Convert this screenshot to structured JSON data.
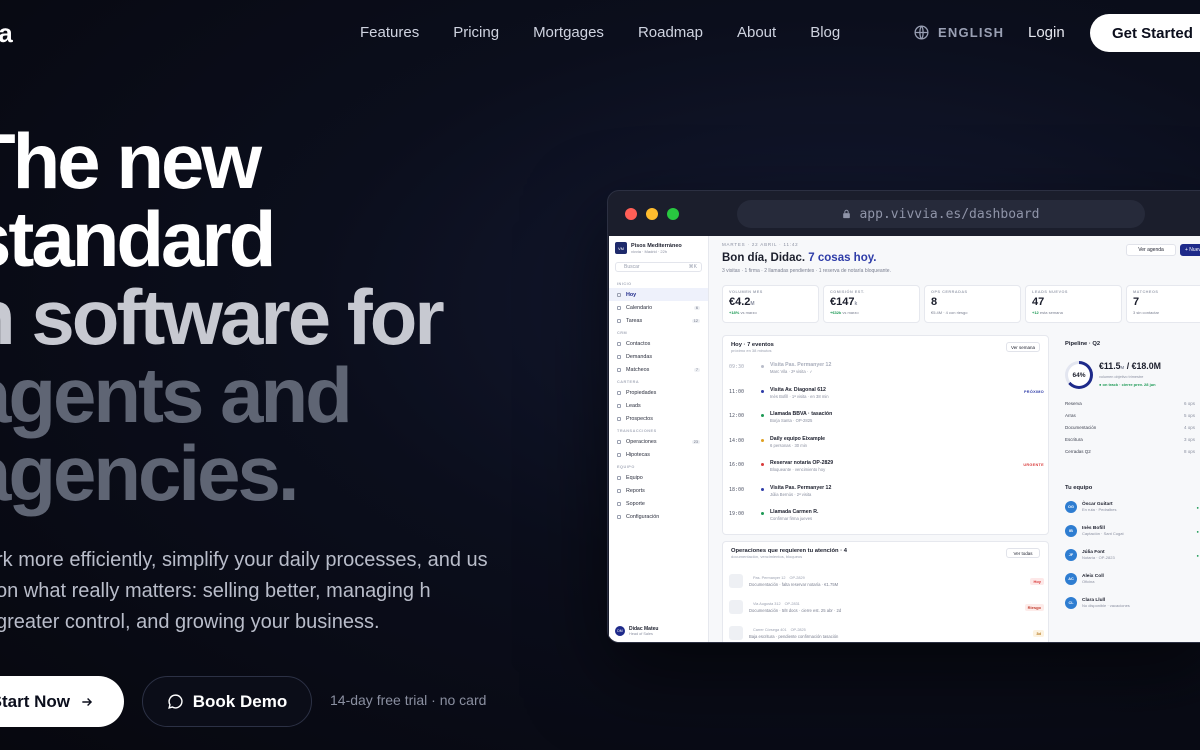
{
  "nav": {
    "logo": "ia",
    "links": [
      "Features",
      "Pricing",
      "Mortgages",
      "Roadmap",
      "About",
      "Blog"
    ],
    "language": "ENGLISH",
    "login": "Login",
    "cta": "Get Started"
  },
  "hero": {
    "lines": [
      "The new",
      "standard",
      "n software for",
      "agents and",
      "agencies."
    ],
    "subtitle": "rk more efficiently, simplify your daily processes, and us on what really matters: selling better, managing h greater control, and growing your business.",
    "primary_cta": "Start Now",
    "secondary_cta": "Book Demo",
    "trial_note": "14-day free trial · no card"
  },
  "browser": {
    "url": "app.vivvia.es/dashboard",
    "dot_colors": [
      "#ff5f57",
      "#febc2e",
      "#28c840"
    ]
  },
  "app": {
    "workspace": {
      "avatar": "VM",
      "name": "Pisos Mediterráneo",
      "sub": "vivvia · Madrid · 22h"
    },
    "search": {
      "placeholder": "Buscar",
      "shortcut": "⌘K"
    },
    "sections": [
      {
        "label": "INICIO",
        "items": [
          {
            "label": "Hoy",
            "count": "",
            "active": true
          },
          {
            "label": "Calendario",
            "count": "6",
            "active": false
          },
          {
            "label": "Tareas",
            "count": "12",
            "active": false
          }
        ]
      },
      {
        "label": "CRM",
        "items": [
          {
            "label": "Contactos",
            "count": "",
            "active": false
          },
          {
            "label": "Demandas",
            "count": "",
            "active": false
          },
          {
            "label": "Matcheos",
            "count": "7",
            "active": false
          }
        ]
      },
      {
        "label": "CARTERA",
        "items": [
          {
            "label": "Propiedades",
            "count": "",
            "active": false
          },
          {
            "label": "Leads",
            "count": "",
            "active": false
          },
          {
            "label": "Prospectos",
            "count": "",
            "active": false
          }
        ]
      },
      {
        "label": "TRANSACCIONES",
        "items": [
          {
            "label": "Operaciones",
            "count": "23",
            "active": false
          },
          {
            "label": "Hipotecas",
            "count": "",
            "active": false
          }
        ]
      },
      {
        "label": "EQUIPO",
        "items": [
          {
            "label": "Equipo",
            "count": "",
            "active": false
          },
          {
            "label": "Reports",
            "count": "",
            "active": false
          },
          {
            "label": "Soporte",
            "count": "",
            "active": false
          },
          {
            "label": "Configuración",
            "count": "",
            "active": false
          }
        ]
      }
    ],
    "user": {
      "avatar": "DM",
      "name": "Didac Mateu",
      "role": "Head of Sales"
    },
    "date_line": "MARTES · 22 ABRIL · 11:42",
    "greeting": "Bon día, Didac.",
    "greeting_highlight": "7 cosas hoy.",
    "greeting_sub": "3 visitas · 1 firma · 2 llamadas pendientes · 1 reserva de notaría bloqueante.",
    "agenda_button": "Ver agenda",
    "new_button": "+ Nueva tarea",
    "kpis": [
      {
        "label": "VOLUMEN MES",
        "value": "€4.2",
        "unit": "M",
        "sub_pos": "+18%",
        "sub": "vs marzo"
      },
      {
        "label": "COMISIÓN EST.",
        "value": "€147",
        "unit": "k",
        "sub_pos": "+€32k",
        "sub": "vs marzo"
      },
      {
        "label": "OPS CERRADAS",
        "value": "8",
        "unit": "",
        "sub_pos": "",
        "sub": "€5.4M · 4 con riesgo"
      },
      {
        "label": "LEADS NUEVOS",
        "value": "47",
        "unit": "",
        "sub_pos": "+12",
        "sub": "esta semana"
      },
      {
        "label": "MATCHEOS",
        "value": "7",
        "unit": "",
        "sub_pos": "",
        "sub": "3 sin contactar"
      }
    ],
    "today": {
      "title": "Hoy · 7 eventos",
      "sub": "próximo en 38 minutos",
      "button": "Ver semana",
      "events": [
        {
          "time": "09:30",
          "title": "Visita Pas. Permanyer 12",
          "sub": "Marc Vila · 2ª visita · ✓",
          "tag": "",
          "done": true,
          "color": "#b9bdca"
        },
        {
          "time": "11:00",
          "title": "Visita Av. Diagonal 612",
          "sub": "Inès Bofill · 1ª visita · en 38 min",
          "tag": "PRÓXIMO",
          "done": false,
          "color": "#2e3ca8"
        },
        {
          "time": "12:00",
          "title": "Llamada BBVA · tasación",
          "sub": "Borja Santa · OP-2825",
          "tag": "",
          "done": false,
          "color": "#1d9a55"
        },
        {
          "time": "14:00",
          "title": "Daily equipo Eixample",
          "sub": "6 personas · 30 min",
          "tag": "",
          "done": false,
          "color": "#e0a020"
        },
        {
          "time": "16:00",
          "title": "Reservar notaría OP-2829",
          "sub": "Bloqueante · vencimiento hoy",
          "tag": "URGENTE",
          "done": false,
          "color": "#d93b3b"
        },
        {
          "time": "18:00",
          "title": "Visita Pas. Permanyer 12",
          "sub": "Júlia Bernús · 2ª visita",
          "tag": "",
          "done": false,
          "color": "#2e3ca8"
        },
        {
          "time": "19:00",
          "title": "Llamada Carmen R.",
          "sub": "Confirmar firma jueves",
          "tag": "",
          "done": false,
          "color": "#1d9a55"
        }
      ]
    },
    "ops": {
      "title": "Operaciones que requieren tu atención · 4",
      "sub": "documentación, vencimientos, bloqueos",
      "button": "Ver todas",
      "items": [
        {
          "title": "Pas. Permanyer 12",
          "code": "OP-2829",
          "sub": "Documentación · falta reservar notaría · €1.75M",
          "badge": "Hoy",
          "badge_color": "#d93b3b",
          "badge_bg": "#fde8e8"
        },
        {
          "title": "Via Augusta 312",
          "code": "OP-2831",
          "sub": "Documentación · 5/8 docs · cierre est. 25 abr · 2d",
          "badge": "Riesgo",
          "badge_color": "#c0392b",
          "badge_bg": "#fdecea"
        },
        {
          "title": "Carrer Còrsega 401",
          "code": "OP-2825",
          "sub": "Baja escritura · pendiente confirmación tasación",
          "badge": "3d",
          "badge_color": "#b7791f",
          "badge_bg": "#fdf3e1"
        }
      ]
    },
    "pipeline": {
      "title": "Pipeline · Q2",
      "percent": "64%",
      "percent_value": 0.64,
      "big": "€11.5",
      "big_unit": "M",
      "target": " / €18.0M",
      "sub": "volumen objetivo trimestre",
      "track": "● on track · cierre prev. 28 jun",
      "stages": [
        {
          "label": "Reserva",
          "n": "6 ops"
        },
        {
          "label": "Arras",
          "n": "5 ops"
        },
        {
          "label": "Documentación",
          "n": "4 ops"
        },
        {
          "label": "Escritura",
          "n": "3 ops"
        },
        {
          "label": "Cerradas Q2",
          "n": "8 ops"
        }
      ]
    },
    "team": {
      "title": "Tu equipo",
      "members": [
        {
          "initials": "OG",
          "name": "Òscar Guitart",
          "role": "En ruta · Pedralbes",
          "status": "● Ac",
          "color": "#2e7dd1"
        },
        {
          "initials": "IB",
          "name": "Inès Bofill",
          "role": "Captación · Sant Cugat",
          "status": "● Ac",
          "color": "#2e7dd1"
        },
        {
          "initials": "JF",
          "name": "Júlia Font",
          "role": "Notaría · OP-2823",
          "status": "● Ac",
          "color": "#2e7dd1"
        },
        {
          "initials": "AC",
          "name": "Aleix Coll",
          "role": "Oficina",
          "status": "",
          "color": "#2e7dd1"
        },
        {
          "initials": "CL",
          "name": "Clara Llull",
          "role": "No disponible · vacaciones",
          "status": "",
          "color": "#2e7dd1"
        }
      ]
    }
  }
}
